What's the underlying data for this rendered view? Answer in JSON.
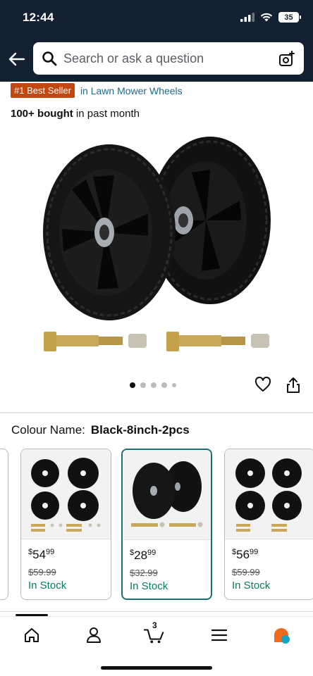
{
  "status_bar": {
    "time": "12:44",
    "battery": "35"
  },
  "search": {
    "placeholder": "Search or ask a question"
  },
  "badge": {
    "label": "#1 Best Seller",
    "category": "in Lawn Mower Wheels"
  },
  "social_proof": {
    "bold": "100+ bought",
    "rest": " in past month"
  },
  "carousel": {
    "dot_count": 5,
    "active_index": 0
  },
  "colour": {
    "label": "Colour Name:",
    "value": "Black-8inch-2pcs"
  },
  "swatches": [
    {
      "currency": "$",
      "price_whole": "54",
      "price_frac": "99",
      "was": "$59.99",
      "stock": "In Stock",
      "selected": false
    },
    {
      "currency": "$",
      "price_whole": "28",
      "price_frac": "99",
      "was": "$32.99",
      "stock": "In Stock",
      "selected": true
    },
    {
      "currency": "$",
      "price_whole": "56",
      "price_frac": "99",
      "was": "$59.99",
      "stock": "In Stock",
      "selected": false
    }
  ],
  "nav": {
    "cart_count": "3"
  },
  "colors": {
    "header": "#132030",
    "best_seller": "#c4470f",
    "link": "#1d6b8c",
    "in_stock": "#067d62",
    "selected_border": "#1b6e78"
  },
  "icons": [
    "back-arrow-icon",
    "search-icon",
    "camera-search-icon",
    "heart-icon",
    "share-icon",
    "home-icon",
    "account-icon",
    "cart-icon",
    "menu-icon",
    "rufus-icon"
  ]
}
